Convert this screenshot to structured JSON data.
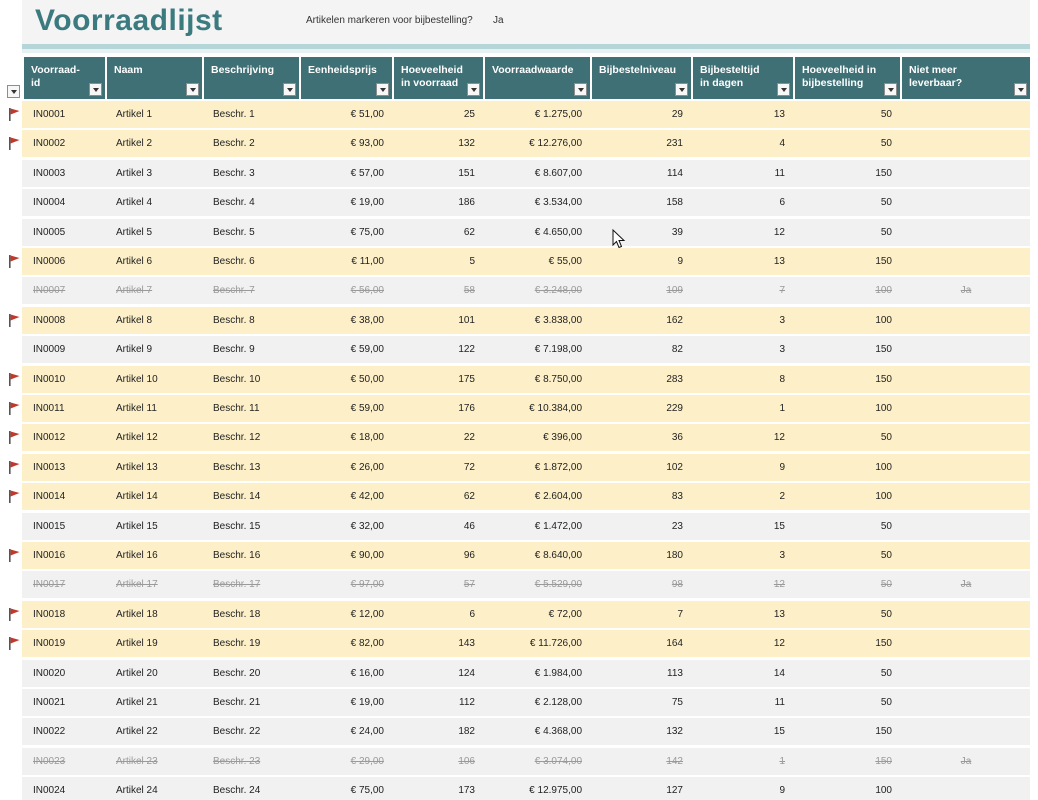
{
  "app": {
    "title": "Voorraadlijst",
    "reorder_prompt": "Artikelen markeren voor bijbestelling?",
    "reorder_value": "Ja"
  },
  "colors": {
    "title": "#3b7a7f",
    "header_bg": "#3e7075",
    "flag_row_bg": "#fdf0c8",
    "plain_row_bg": "#f1f1f1",
    "flag_icon": "#c0392b"
  },
  "icons": {
    "flag": "red-flag-icon",
    "filter": "filter-dropdown-icon",
    "cursor": "mouse-pointer-icon"
  },
  "table": {
    "headers": [
      "Voorraad-id",
      "Naam",
      "Beschrijving",
      "Eenheidsprijs",
      "Hoeveelheid in voorraad",
      "Voorraadwaarde",
      "Bijbestelniveau",
      "Bijbesteltijd in dagen",
      "Hoeveelheid in bijbestelling",
      "Niet meer leverbaar?"
    ],
    "rows": [
      {
        "flag": true,
        "disc": false,
        "cells": [
          "IN0001",
          "Artikel 1",
          "Beschr. 1",
          "€ 51,00",
          "25",
          "€ 1.275,00",
          "29",
          "13",
          "50",
          ""
        ]
      },
      {
        "flag": true,
        "disc": false,
        "cells": [
          "IN0002",
          "Artikel 2",
          "Beschr. 2",
          "€ 93,00",
          "132",
          "€ 12.276,00",
          "231",
          "4",
          "50",
          ""
        ]
      },
      {
        "flag": false,
        "disc": false,
        "cells": [
          "IN0003",
          "Artikel 3",
          "Beschr. 3",
          "€ 57,00",
          "151",
          "€ 8.607,00",
          "114",
          "11",
          "150",
          ""
        ]
      },
      {
        "flag": false,
        "disc": false,
        "cells": [
          "IN0004",
          "Artikel 4",
          "Beschr. 4",
          "€ 19,00",
          "186",
          "€ 3.534,00",
          "158",
          "6",
          "50",
          ""
        ]
      },
      {
        "flag": false,
        "disc": false,
        "cells": [
          "IN0005",
          "Artikel 5",
          "Beschr. 5",
          "€ 75,00",
          "62",
          "€ 4.650,00",
          "39",
          "12",
          "50",
          ""
        ]
      },
      {
        "flag": true,
        "disc": false,
        "cells": [
          "IN0006",
          "Artikel 6",
          "Beschr. 6",
          "€ 11,00",
          "5",
          "€ 55,00",
          "9",
          "13",
          "150",
          ""
        ]
      },
      {
        "flag": false,
        "disc": true,
        "cells": [
          "IN0007",
          "Artikel 7",
          "Beschr. 7",
          "€ 56,00",
          "58",
          "€ 3.248,00",
          "109",
          "7",
          "100",
          "Ja"
        ]
      },
      {
        "flag": true,
        "disc": false,
        "cells": [
          "IN0008",
          "Artikel 8",
          "Beschr. 8",
          "€ 38,00",
          "101",
          "€ 3.838,00",
          "162",
          "3",
          "100",
          ""
        ]
      },
      {
        "flag": false,
        "disc": false,
        "cells": [
          "IN0009",
          "Artikel 9",
          "Beschr. 9",
          "€ 59,00",
          "122",
          "€ 7.198,00",
          "82",
          "3",
          "150",
          ""
        ]
      },
      {
        "flag": true,
        "disc": false,
        "cells": [
          "IN0010",
          "Artikel 10",
          "Beschr. 10",
          "€ 50,00",
          "175",
          "€ 8.750,00",
          "283",
          "8",
          "150",
          ""
        ]
      },
      {
        "flag": true,
        "disc": false,
        "cells": [
          "IN0011",
          "Artikel 11",
          "Beschr. 11",
          "€ 59,00",
          "176",
          "€ 10.384,00",
          "229",
          "1",
          "100",
          ""
        ]
      },
      {
        "flag": true,
        "disc": false,
        "cells": [
          "IN0012",
          "Artikel 12",
          "Beschr. 12",
          "€ 18,00",
          "22",
          "€ 396,00",
          "36",
          "12",
          "50",
          ""
        ]
      },
      {
        "flag": true,
        "disc": false,
        "cells": [
          "IN0013",
          "Artikel 13",
          "Beschr. 13",
          "€ 26,00",
          "72",
          "€ 1.872,00",
          "102",
          "9",
          "100",
          ""
        ]
      },
      {
        "flag": true,
        "disc": false,
        "cells": [
          "IN0014",
          "Artikel 14",
          "Beschr. 14",
          "€ 42,00",
          "62",
          "€ 2.604,00",
          "83",
          "2",
          "100",
          ""
        ]
      },
      {
        "flag": false,
        "disc": false,
        "cells": [
          "IN0015",
          "Artikel 15",
          "Beschr. 15",
          "€ 32,00",
          "46",
          "€ 1.472,00",
          "23",
          "15",
          "50",
          ""
        ]
      },
      {
        "flag": true,
        "disc": false,
        "cells": [
          "IN0016",
          "Artikel 16",
          "Beschr. 16",
          "€ 90,00",
          "96",
          "€ 8.640,00",
          "180",
          "3",
          "50",
          ""
        ]
      },
      {
        "flag": false,
        "disc": true,
        "cells": [
          "IN0017",
          "Artikel 17",
          "Beschr. 17",
          "€ 97,00",
          "57",
          "€ 5.529,00",
          "98",
          "12",
          "50",
          "Ja"
        ]
      },
      {
        "flag": true,
        "disc": false,
        "cells": [
          "IN0018",
          "Artikel 18",
          "Beschr. 18",
          "€ 12,00",
          "6",
          "€ 72,00",
          "7",
          "13",
          "50",
          ""
        ]
      },
      {
        "flag": true,
        "disc": false,
        "cells": [
          "IN0019",
          "Artikel 19",
          "Beschr. 19",
          "€ 82,00",
          "143",
          "€ 11.726,00",
          "164",
          "12",
          "150",
          ""
        ]
      },
      {
        "flag": false,
        "disc": false,
        "cells": [
          "IN0020",
          "Artikel 20",
          "Beschr. 20",
          "€ 16,00",
          "124",
          "€ 1.984,00",
          "113",
          "14",
          "50",
          ""
        ]
      },
      {
        "flag": false,
        "disc": false,
        "cells": [
          "IN0021",
          "Artikel 21",
          "Beschr. 21",
          "€ 19,00",
          "112",
          "€ 2.128,00",
          "75",
          "11",
          "50",
          ""
        ]
      },
      {
        "flag": false,
        "disc": false,
        "cells": [
          "IN0022",
          "Artikel 22",
          "Beschr. 22",
          "€ 24,00",
          "182",
          "€ 4.368,00",
          "132",
          "15",
          "150",
          ""
        ]
      },
      {
        "flag": false,
        "disc": true,
        "cells": [
          "IN0023",
          "Artikel 23",
          "Beschr. 23",
          "€ 29,00",
          "106",
          "€ 3.074,00",
          "142",
          "1",
          "150",
          "Ja"
        ]
      },
      {
        "flag": false,
        "disc": false,
        "cells": [
          "IN0024",
          "Artikel 24",
          "Beschr. 24",
          "€ 75,00",
          "173",
          "€ 12.975,00",
          "127",
          "9",
          "100",
          ""
        ]
      }
    ]
  }
}
